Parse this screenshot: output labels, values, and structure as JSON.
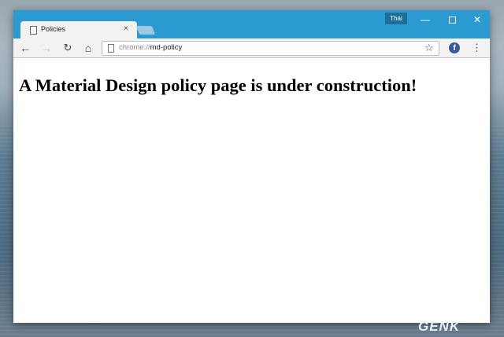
{
  "browser": {
    "profile_name": "Thái",
    "window_controls": {
      "minimize_glyph": "—",
      "close_glyph": "✕"
    },
    "tab": {
      "title": "Policies",
      "close_glyph": "×",
      "icon": "document-icon"
    },
    "toolbar": {
      "back_glyph": "←",
      "forward_glyph": "→",
      "reload_glyph": "↻",
      "home_glyph": "⌂",
      "bookmark_glyph": "☆",
      "menu_glyph": "⋮",
      "extension_letter": "f"
    },
    "omnibox": {
      "url_scheme": "chrome://",
      "url_path": "md-policy"
    }
  },
  "page": {
    "heading": "A Material Design policy page is under construction!"
  },
  "watermark": "GENK",
  "colors": {
    "titlebar": "#2b9ad0",
    "profile_badge": "#1d6f99",
    "facebook_blue": "#3b5998"
  }
}
